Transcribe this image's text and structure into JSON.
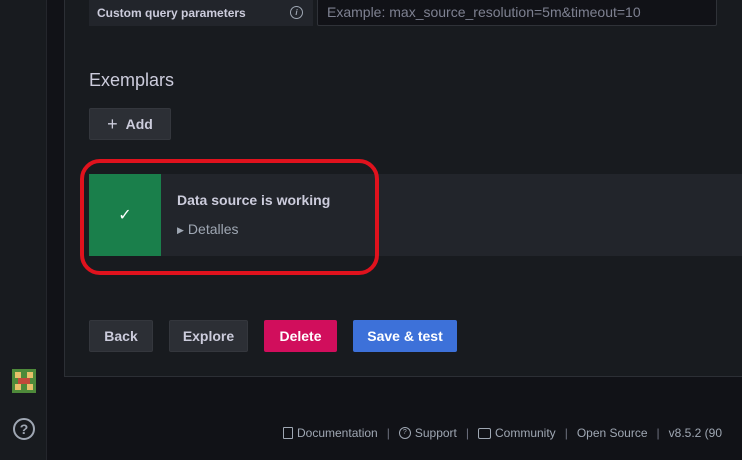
{
  "params": {
    "label": "Custom query parameters",
    "placeholder": "Example: max_source_resolution=5m&timeout=10"
  },
  "exemplars": {
    "title": "Exemplars",
    "add_label": "Add"
  },
  "alert": {
    "title": "Data source is working",
    "details": "Detalles",
    "status_color": "#1a7f4b"
  },
  "buttons": {
    "back": "Back",
    "explore": "Explore",
    "delete": "Delete",
    "save": "Save & test"
  },
  "footer": {
    "documentation": "Documentation",
    "support": "Support",
    "community": "Community",
    "open_source": "Open Source",
    "version": "v8.5.2 (90"
  },
  "colors": {
    "highlight": "#e0121d",
    "delete": "#d10e5c",
    "primary": "#3d71d9"
  }
}
